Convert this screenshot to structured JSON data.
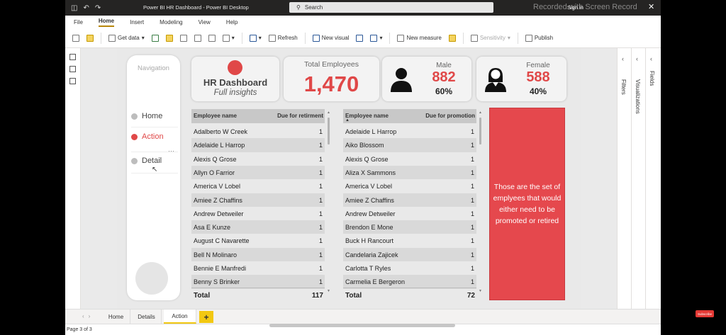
{
  "window": {
    "title": "Power BI HR Dashboard - Power BI Desktop",
    "search_placeholder": "Search",
    "sign_in": "Sign in",
    "watermark": "Recorded with Screen Record"
  },
  "menu": {
    "items": [
      "File",
      "Home",
      "Insert",
      "Modeling",
      "View",
      "Help"
    ],
    "active": "Home"
  },
  "ribbon": {
    "get_data": "Get data",
    "refresh": "Refresh",
    "new_visual": "New visual",
    "new_measure": "New measure",
    "sensitivity": "Sensitivity",
    "publish": "Publish"
  },
  "navigation": {
    "title": "Navigation",
    "items": [
      {
        "label": "Home",
        "active": false
      },
      {
        "label": "Action",
        "active": true
      },
      {
        "label": "Detail",
        "active": false
      }
    ]
  },
  "hr_card": {
    "title": "HR Dashboard",
    "subtitle": "Full insights"
  },
  "total_employees": {
    "label": "Total Employees",
    "value": "1,470"
  },
  "male": {
    "label": "Male",
    "count": "882",
    "percent": "60%"
  },
  "female": {
    "label": "Female",
    "count": "588",
    "percent": "40%"
  },
  "retirement_table": {
    "col_name": "Employee name",
    "col_value": "Due for retirment",
    "rows": [
      {
        "name": "Adalberto W Creek",
        "value": "1"
      },
      {
        "name": "Adelaide L Harrop",
        "value": "1"
      },
      {
        "name": "Alexis Q Grose",
        "value": "1"
      },
      {
        "name": "Allyn O Farrior",
        "value": "1"
      },
      {
        "name": "America V Lobel",
        "value": "1"
      },
      {
        "name": "Amiee Z Chaffins",
        "value": "1"
      },
      {
        "name": "Andrew Detweiler",
        "value": "1"
      },
      {
        "name": "Asa E Kunze",
        "value": "1"
      },
      {
        "name": "August C Navarette",
        "value": "1"
      },
      {
        "name": "Bell N Molinaro",
        "value": "1"
      },
      {
        "name": "Bennie E Manfredi",
        "value": "1"
      },
      {
        "name": "Benny S Brinker",
        "value": "1"
      }
    ],
    "total_label": "Total",
    "total_value": "117"
  },
  "promotion_table": {
    "col_name": "Employee name",
    "col_value": "Due for promotion",
    "rows": [
      {
        "name": "Adelaide L Harrop",
        "value": "1"
      },
      {
        "name": "Aiko Blossom",
        "value": "1"
      },
      {
        "name": "Alexis Q Grose",
        "value": "1"
      },
      {
        "name": "Aliza X Sammons",
        "value": "1"
      },
      {
        "name": "America V Lobel",
        "value": "1"
      },
      {
        "name": "Amiee Z Chaffins",
        "value": "1"
      },
      {
        "name": "Andrew Detweiler",
        "value": "1"
      },
      {
        "name": "Brendon E Mone",
        "value": "1"
      },
      {
        "name": "Buck H Rancourt",
        "value": "1"
      },
      {
        "name": "Candelaria Zajicek",
        "value": "1"
      },
      {
        "name": "Carlotta T Ryles",
        "value": "1"
      },
      {
        "name": "Carmelia E Bergeron",
        "value": "1"
      }
    ],
    "total_label": "Total",
    "total_value": "72"
  },
  "info_box": {
    "text": "Those are the set of emplyees that would either need to be promoted or retired"
  },
  "side_panes": [
    "Fields",
    "Visualizations",
    "Filters"
  ],
  "page_tabs": {
    "tabs": [
      "Home",
      "Details",
      "Action"
    ],
    "active": "Action",
    "add": "+"
  },
  "status": {
    "page": "Page 3 of 3"
  },
  "youtube": {
    "subscribe": "Subscribe"
  },
  "colors": {
    "accent_red": "#e04848",
    "powerbi_yellow": "#f2c811"
  }
}
